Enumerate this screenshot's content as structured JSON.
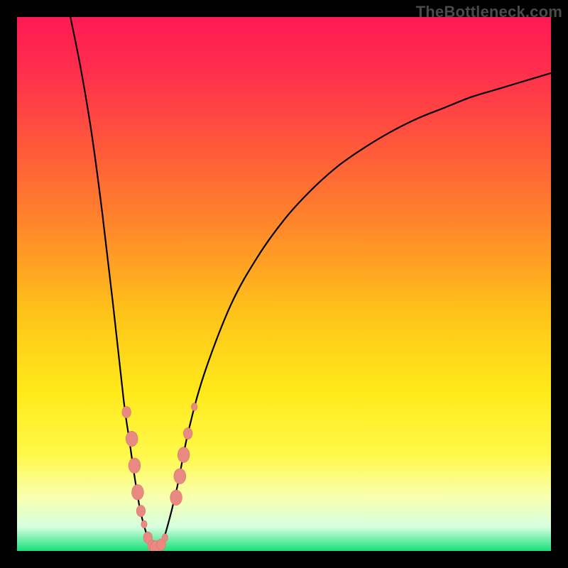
{
  "watermark": "TheBottleneck.com",
  "colors": {
    "gradient_stops": [
      {
        "offset": 0.0,
        "color": "#ff1a53"
      },
      {
        "offset": 0.1,
        "color": "#ff2e4d"
      },
      {
        "offset": 0.25,
        "color": "#ff5a3a"
      },
      {
        "offset": 0.4,
        "color": "#ff8a2a"
      },
      {
        "offset": 0.55,
        "color": "#ffc21a"
      },
      {
        "offset": 0.7,
        "color": "#ffe91a"
      },
      {
        "offset": 0.82,
        "color": "#fff94a"
      },
      {
        "offset": 0.9,
        "color": "#f8ffb0"
      },
      {
        "offset": 0.955,
        "color": "#d6ffe0"
      },
      {
        "offset": 1.0,
        "color": "#18e07a"
      }
    ],
    "curve": "#000000",
    "marker_fill": "#e88a82",
    "marker_stroke": "#d9736b"
  },
  "chart_data": {
    "type": "line",
    "title": "",
    "xlabel": "",
    "ylabel": "",
    "xlim": [
      0,
      100
    ],
    "ylim": [
      0,
      100
    ],
    "grid": false,
    "legend": false,
    "series": [
      {
        "name": "bottleneck-curve-left",
        "x": [
          10,
          12,
          14,
          16,
          18,
          20,
          21,
          22,
          23,
          24,
          25,
          26
        ],
        "values": [
          100,
          90,
          78,
          63,
          46,
          28,
          21,
          14,
          8,
          4,
          1.5,
          0.5
        ]
      },
      {
        "name": "bottleneck-curve-right",
        "x": [
          26,
          27,
          28,
          30,
          32,
          35,
          40,
          45,
          50,
          55,
          60,
          65,
          70,
          75,
          80,
          85,
          90,
          95,
          100
        ],
        "values": [
          0.5,
          1.5,
          4,
          12,
          22,
          33,
          46,
          55,
          62,
          67.5,
          72,
          75.5,
          78.5,
          81,
          83,
          85,
          86.5,
          88,
          89.5
        ]
      }
    ],
    "markers": [
      {
        "x": 20.5,
        "y": 26,
        "size": "md"
      },
      {
        "x": 21.5,
        "y": 21,
        "size": "lg"
      },
      {
        "x": 22.0,
        "y": 16,
        "size": "lg"
      },
      {
        "x": 22.6,
        "y": 11,
        "size": "lg"
      },
      {
        "x": 23.2,
        "y": 7.5,
        "size": "md"
      },
      {
        "x": 23.8,
        "y": 5.0,
        "size": "sm"
      },
      {
        "x": 24.5,
        "y": 2.5,
        "size": "md"
      },
      {
        "x": 25.3,
        "y": 1.0,
        "size": "md"
      },
      {
        "x": 26.0,
        "y": 0.5,
        "size": "lg"
      },
      {
        "x": 27.0,
        "y": 1.2,
        "size": "md"
      },
      {
        "x": 27.7,
        "y": 2.5,
        "size": "sm"
      },
      {
        "x": 29.8,
        "y": 10,
        "size": "lg"
      },
      {
        "x": 30.5,
        "y": 14,
        "size": "lg"
      },
      {
        "x": 31.2,
        "y": 18,
        "size": "lg"
      },
      {
        "x": 32.0,
        "y": 22,
        "size": "md"
      },
      {
        "x": 33.2,
        "y": 27,
        "size": "sm"
      }
    ],
    "marker_sizes": {
      "sm": 4,
      "md": 6,
      "lg": 8
    }
  }
}
